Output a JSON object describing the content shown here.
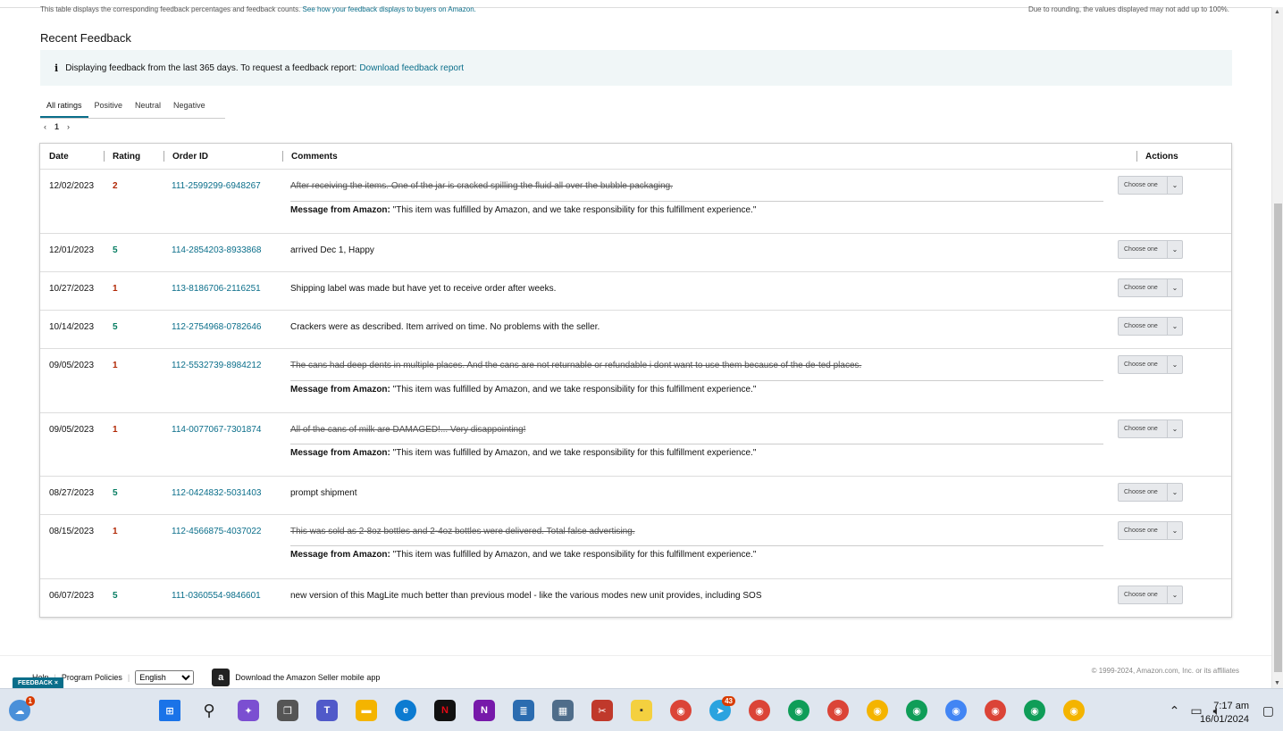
{
  "top_note": {
    "left": "This table displays the corresponding feedback percentages and feedback counts.",
    "left_link": "See how your feedback displays to buyers on Amazon.",
    "right": "Due to rounding, the values displayed may not add up to 100%."
  },
  "section_title": "Recent Feedback",
  "info": {
    "text": "Displaying feedback from the last 365 days. To request a feedback report:",
    "link": "Download feedback report"
  },
  "tabs": [
    "All ratings",
    "Positive",
    "Neutral",
    "Negative"
  ],
  "pager": {
    "prev": "‹",
    "page": "1",
    "next": "›"
  },
  "columns": {
    "date": "Date",
    "rating": "Rating",
    "order_id": "Order ID",
    "comments": "Comments",
    "actions": "Actions"
  },
  "amazon_msg_label": "Message from Amazon:",
  "amazon_msg_text": "\"This item was fulfilled by Amazon, and we take responsibility for this fulfillment experience.\"",
  "choose_label": "Choose one",
  "rows": [
    {
      "date": "12/02/2023",
      "rating": "2",
      "order_id": "111-2599299-6948267",
      "comment": "After receiving the items. One of the jar is cracked spilling the fluid all over the bubble packaging.",
      "struck": true
    },
    {
      "date": "12/01/2023",
      "rating": "5",
      "order_id": "114-2854203-8933868",
      "comment": "arrived Dec 1, Happy",
      "struck": false
    },
    {
      "date": "10/27/2023",
      "rating": "1",
      "order_id": "113-8186706-2116251",
      "comment": "Shipping label was made but have yet to receive order after weeks.",
      "struck": false
    },
    {
      "date": "10/14/2023",
      "rating": "5",
      "order_id": "112-2754968-0782646",
      "comment": "Crackers were as described. Item arrived on time. No problems with the seller.",
      "struck": false
    },
    {
      "date": "09/05/2023",
      "rating": "1",
      "order_id": "112-5532739-8984212",
      "comment": "The cans had deep dents in multiple places. And the cans are not returnable or refundable i dont want to use them because of the de-ted places.",
      "struck": true
    },
    {
      "date": "09/05/2023",
      "rating": "1",
      "order_id": "114-0077067-7301874",
      "comment": "All of the cans of milk are DAMAGED!... Very disappointing!",
      "struck": true
    },
    {
      "date": "08/27/2023",
      "rating": "5",
      "order_id": "112-0424832-5031403",
      "comment": "prompt shipment",
      "struck": false
    },
    {
      "date": "08/15/2023",
      "rating": "1",
      "order_id": "112-4566875-4037022",
      "comment": "This was sold as 2-8oz bottles and 2-4oz bottles were delivered. Total false advertising.",
      "struck": true
    },
    {
      "date": "06/07/2023",
      "rating": "5",
      "order_id": "111-0360554-9846601",
      "comment": "new version of this MagLite much better than previous model - like the various modes new unit provides, including SOS",
      "struck": false
    }
  ],
  "footer": {
    "help": "Help",
    "policies": "Program Policies",
    "language": "English",
    "app_text": "Download the Amazon Seller mobile app",
    "copyright": "© 1999-2024, Amazon.com, Inc. or its affiliates"
  },
  "feedback_badge": "FEEDBACK ×",
  "taskbar": {
    "weather_badge": "1",
    "telegram_badge": "43",
    "time": "7:17 am",
    "date": "16/01/2024"
  }
}
